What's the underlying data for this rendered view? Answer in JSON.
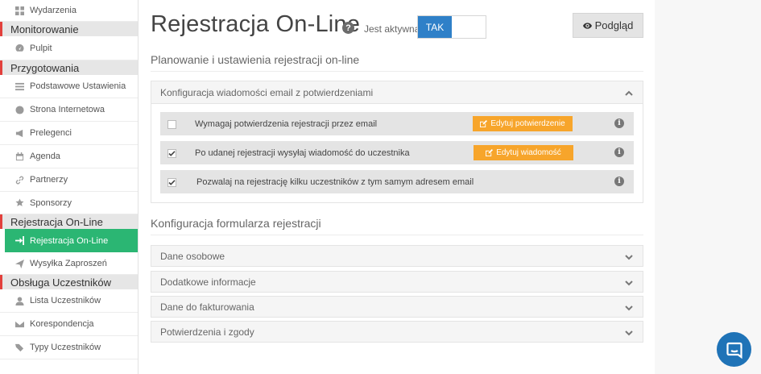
{
  "sidebar": {
    "items": [
      {
        "type": "item",
        "label": "Wydarzenia",
        "icon": "dashboard-icon"
      },
      {
        "type": "section",
        "label": "Monitorowanie"
      },
      {
        "type": "item",
        "label": "Pulpit",
        "icon": "gauge-icon"
      },
      {
        "type": "section",
        "label": "Przygotowania"
      },
      {
        "type": "item",
        "label": "Podstawowe Ustawienia",
        "icon": "list-icon"
      },
      {
        "type": "item",
        "label": "Strona Internetowa",
        "icon": "globe-icon"
      },
      {
        "type": "item",
        "label": "Prelegenci",
        "icon": "megaphone-icon"
      },
      {
        "type": "item",
        "label": "Agenda",
        "icon": "calendar-icon"
      },
      {
        "type": "item",
        "label": "Partnerzy",
        "icon": "link-icon"
      },
      {
        "type": "item",
        "label": "Sponsorzy",
        "icon": "star-icon"
      },
      {
        "type": "section",
        "label": "Rejestracja On-Line"
      },
      {
        "type": "item",
        "label": "Rejestracja On-Line",
        "icon": "sign-in-icon",
        "active": true
      },
      {
        "type": "item",
        "label": "Wysyłka Zaproszeń",
        "icon": "send-icon"
      },
      {
        "type": "section",
        "label": "Obsługa Uczestników"
      },
      {
        "type": "item",
        "label": "Lista Uczestników",
        "icon": "user-icon"
      },
      {
        "type": "item",
        "label": "Korespondencja",
        "icon": "envelope-icon"
      },
      {
        "type": "item",
        "label": "Typy Uczestników",
        "icon": "tags-icon"
      }
    ]
  },
  "header": {
    "title": "Rejestracja On-Line",
    "active_label": "Jest aktywna",
    "toggle_value": "TAK",
    "preview_label": "Podgląd"
  },
  "planning": {
    "heading": "Planowanie i ustawienia rejestracji on-line",
    "panel_title": "Konfiguracja wiadomości email z potwierdzeniami",
    "rows": [
      {
        "label": "Wymagaj potwierdzenia rejestracji przez email",
        "checked": false,
        "button": "Edytuj potwierdzenie"
      },
      {
        "label": "Po udanej rejestracji wysyłaj wiadomość do uczestnika",
        "checked": true,
        "button": "Edytuj wiadomość"
      },
      {
        "label": "Pozwalaj na rejestrację kilku uczestników z tym samym adresem email",
        "checked": true,
        "button": ""
      }
    ]
  },
  "form_config": {
    "heading": "Konfiguracja formularza rejestracji",
    "sections": [
      "Dane osobowe",
      "Dodatkowe informacje",
      "Dane do fakturowania",
      "Potwierdzenia i zgody"
    ]
  },
  "colors": {
    "accent_green": "#2bb673",
    "section_marker": "#e2403c",
    "toggle_blue": "#2f80c8",
    "edit_orange": "#f7a52b",
    "chat_blue": "#1f73b7"
  }
}
